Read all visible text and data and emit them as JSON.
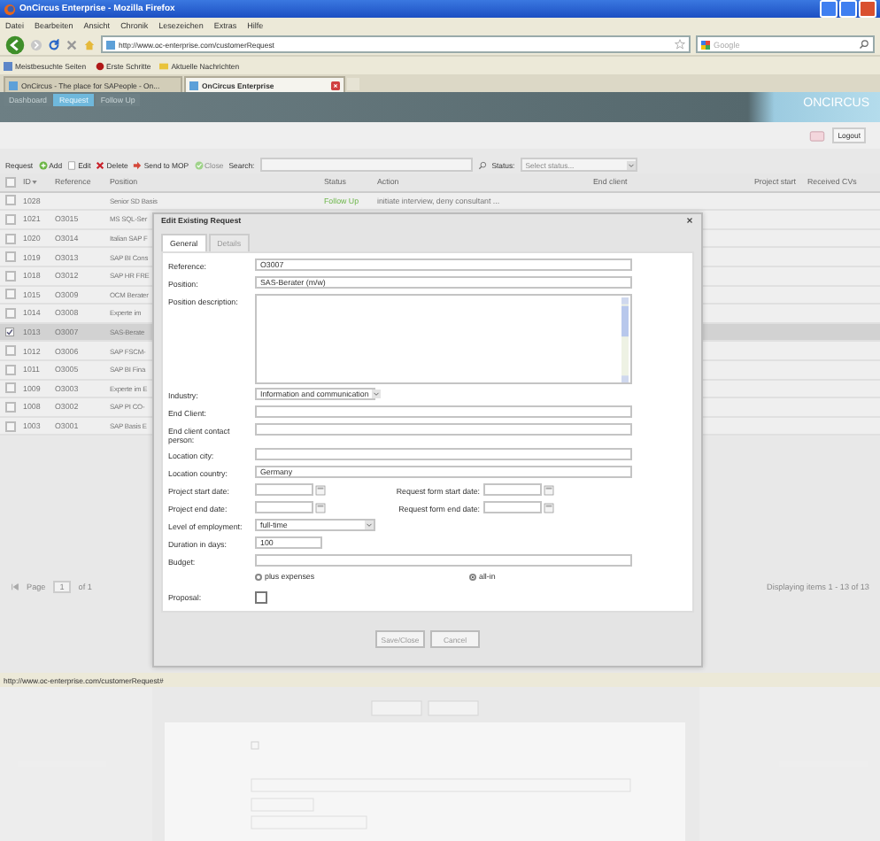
{
  "window": {
    "title": "OnCircus Enterprise - Mozilla Firefox"
  },
  "menu": [
    "Datei",
    "Bearbeiten",
    "Ansicht",
    "Chronik",
    "Lesezeichen",
    "Extras",
    "Hilfe"
  ],
  "address_bar": {
    "url": "http://www.oc-enterprise.com/customerRequest"
  },
  "search_box": {
    "placeholder": "Google"
  },
  "bookmarks": [
    "Meistbesuchte Seiten",
    "Erste Schritte",
    "Aktuelle Nachrichten"
  ],
  "browser_tabs": [
    {
      "title": "OnCircus - The place for SAPeople - On...",
      "selected": false
    },
    {
      "title": "OnCircus Enterprise",
      "selected": true
    }
  ],
  "app": {
    "nav_tabs": [
      {
        "label": "Dashboard",
        "selected": false
      },
      {
        "label": "Request",
        "selected": true
      },
      {
        "label": "Follow Up",
        "selected": false
      }
    ],
    "logo": "ONCIRCUS",
    "logout": "Logout",
    "toolbar": {
      "title": "Request",
      "buttons": [
        {
          "label": "Add",
          "kind": "add",
          "disabled": false
        },
        {
          "label": "Edit",
          "kind": "edit",
          "disabled": false
        },
        {
          "label": "Delete",
          "kind": "delete",
          "disabled": false
        },
        {
          "label": "Send to MOP",
          "kind": "send",
          "disabled": false
        },
        {
          "label": "Close",
          "kind": "close",
          "disabled": true
        }
      ],
      "search_label": "Search:",
      "status_label": "Status:",
      "status_placeholder": "Select status..."
    },
    "grid": {
      "select_all": {
        "checked": false
      },
      "columns": [
        "ID",
        "Reference",
        "Position",
        "Status",
        "Action",
        "End client",
        "Project start",
        "Received CVs"
      ],
      "rows": [
        {
          "id": "1028",
          "reference": "",
          "position": "Senior SD Basis",
          "status": "Follow Up",
          "action": "initiate interview, deny consultant ...",
          "selected": false
        },
        {
          "id": "1021",
          "reference": "O3015",
          "position": "MS SQL-Ser",
          "selected": false
        },
        {
          "id": "1020",
          "reference": "O3014",
          "position": "Italian SAP F",
          "selected": false
        },
        {
          "id": "1019",
          "reference": "O3013",
          "position": "SAP BI Cons",
          "selected": false
        },
        {
          "id": "1018",
          "reference": "O3012",
          "position": "SAP HR FRE",
          "selected": false
        },
        {
          "id": "1015",
          "reference": "O3009",
          "position": "OCM Berater",
          "selected": false
        },
        {
          "id": "1014",
          "reference": "O3008",
          "position": "Experte im",
          "selected": false
        },
        {
          "id": "1013",
          "reference": "O3007",
          "position": "SAS-Berate",
          "selected": true
        },
        {
          "id": "1012",
          "reference": "O3006",
          "position": "SAP FSCM-",
          "selected": false
        },
        {
          "id": "1011",
          "reference": "O3005",
          "position": "SAP BI Fina",
          "selected": false
        },
        {
          "id": "1009",
          "reference": "O3003",
          "position": "Experte im E",
          "selected": false
        },
        {
          "id": "1008",
          "reference": "O3002",
          "position": "SAP PI CO-",
          "selected": false
        },
        {
          "id": "1003",
          "reference": "O3001",
          "position": "SAP Basis E",
          "selected": false
        }
      ]
    },
    "pager": {
      "page_label": "Page",
      "page": "1",
      "of": "of 1",
      "summary": "Displaying items 1 - 13 of 13"
    }
  },
  "dialog": {
    "title": "Edit Existing Request",
    "tabs": [
      {
        "label": "General",
        "selected": true
      },
      {
        "label": "Details",
        "selected": false
      }
    ],
    "fields": [
      {
        "kind": "text",
        "label": "Reference:",
        "value": "O3007"
      },
      {
        "kind": "text",
        "label": "Position:",
        "value": "SAS-Berater (m/w)"
      },
      {
        "kind": "textarea",
        "label": "Position description:"
      },
      {
        "kind": "select",
        "label": "Industry:",
        "value": "Information and communication"
      },
      {
        "kind": "text",
        "label": "End Client:"
      },
      {
        "kind": "text",
        "label": "End client contact person:"
      },
      {
        "kind": "text",
        "label": "Location city:"
      },
      {
        "kind": "text",
        "label": "Location country:",
        "value": "Germany"
      },
      {
        "kind": "date_pair",
        "label": "Project start date:",
        "label_2": "Request form start date:"
      },
      {
        "kind": "date_pair",
        "label": "Project end date:",
        "label_2": "Request form end date:"
      },
      {
        "kind": "select_wide",
        "label": "Level of employment:",
        "value": "full-time"
      },
      {
        "kind": "short",
        "label": "Duration in days:",
        "value": "100"
      },
      {
        "kind": "text",
        "label": "Budget:"
      },
      {
        "kind": "radios",
        "options": [
          {
            "label": "plus expenses",
            "selected": false
          },
          {
            "label": "all-in",
            "selected": true
          }
        ]
      },
      {
        "kind": "checkbox",
        "label": "Proposal:",
        "checked": false
      }
    ],
    "buttons": [
      "Save/Close",
      "Cancel"
    ]
  },
  "status_bar": "http://www.oc-enterprise.com/customerRequest#"
}
